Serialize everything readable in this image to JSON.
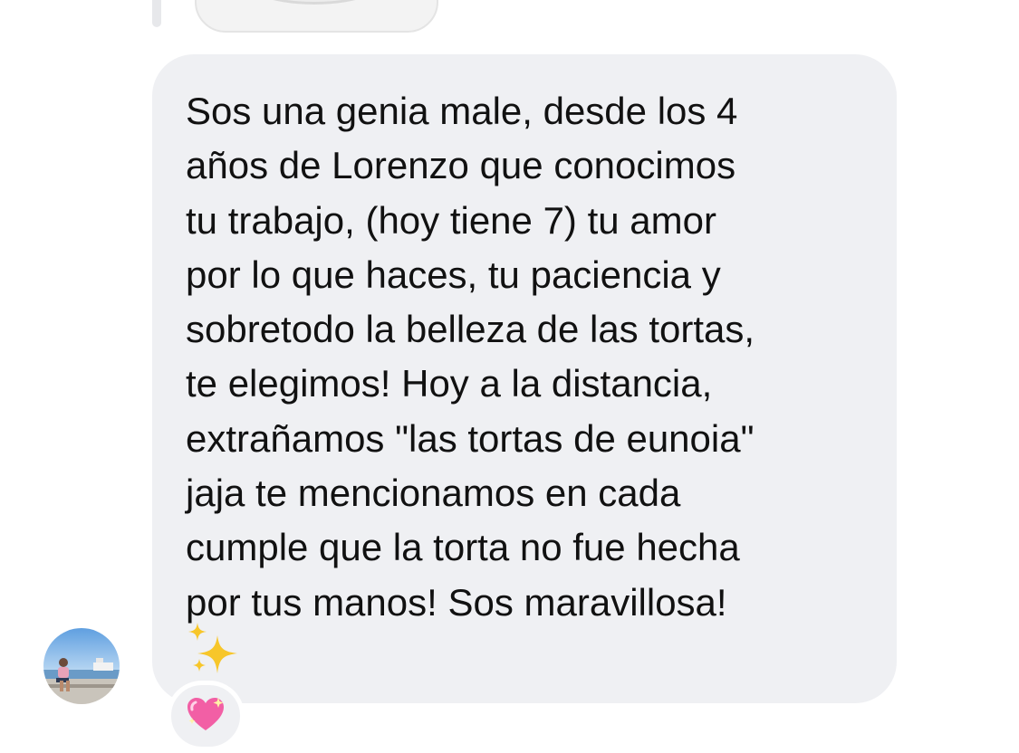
{
  "message": {
    "text": "Sos una genia male, desde los 4\naños de Lorenzo que conocimos\ntu trabajo,  (hoy tiene 7) tu amor\npor lo que haces, tu paciencia y\nsobretodo la belleza de las tortas,\nte elegimos! Hoy a la distancia,\nextrañamos \"las tortas de eunoia\"\njaja te mencionamos en cada\ncumple que la torta no fue hecha\npor tus manos! Sos maravillosa!",
    "trailing_emoji": "sparkles-icon"
  },
  "reaction": {
    "emoji": "sparkling-heart-icon"
  },
  "sender": {
    "avatar": "profile-photo-beach"
  },
  "colors": {
    "bubble": "#eff0f3",
    "text": "#111111",
    "heart": "#f25fa5",
    "sparkle": "#f7c62a"
  }
}
